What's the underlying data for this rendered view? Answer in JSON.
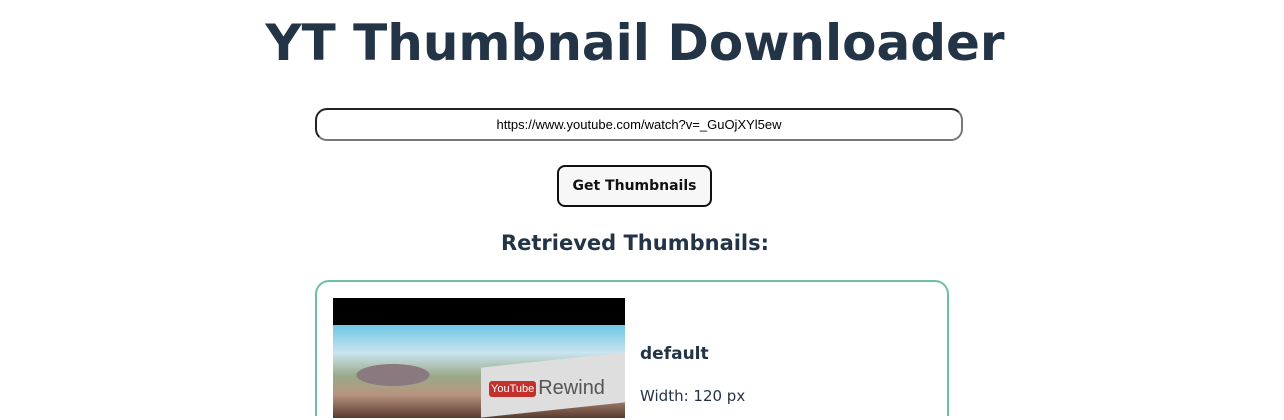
{
  "header": {
    "title": "YT Thumbnail Downloader"
  },
  "form": {
    "url_value": "https://www.youtube.com/watch?v=_GuOjXYl5ew",
    "submit_label": "Get Thumbnails"
  },
  "results": {
    "heading": "Retrieved Thumbnails:",
    "items": [
      {
        "name": "default",
        "width_text": "Width: 120 px",
        "image_text": "Rewind",
        "image_logo": "YouTube"
      }
    ]
  },
  "colors": {
    "text": "#233447",
    "card_border": "#6dbf9f"
  }
}
